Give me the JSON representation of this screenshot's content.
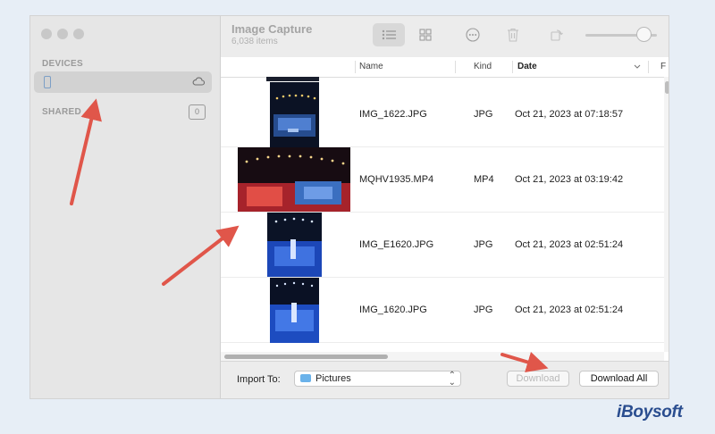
{
  "app": {
    "title": "Image Capture",
    "item_count": "6,038 items"
  },
  "sidebar": {
    "devices_heading": "DEVICES",
    "shared_heading": "SHARED",
    "shared_count": "0",
    "device": {
      "name": "",
      "icon": "iphone-icon",
      "status_icon": "cloud-icon"
    }
  },
  "toolbar": {
    "view_buttons": [
      "list-view-icon",
      "grid-view-icon"
    ],
    "actions": [
      "more-icon",
      "trash-icon",
      "rotate-icon"
    ],
    "thumbnail_size_slider": 0.85
  },
  "columns": {
    "name": "Name",
    "kind": "Kind",
    "date": "Date",
    "extra": "F"
  },
  "rows": [
    {
      "name": "IMG_1622.JPG",
      "kind": "JPG",
      "date": "Oct 21, 2023 at 07:18:57",
      "thumb": "portrait"
    },
    {
      "name": "MQHV1935.MP4",
      "kind": "MP4",
      "date": "Oct 21, 2023 at 03:19:42",
      "thumb": "landscape"
    },
    {
      "name": "IMG_E1620.JPG",
      "kind": "JPG",
      "date": "Oct 21, 2023 at 02:51:24",
      "thumb": "portrait"
    },
    {
      "name": "IMG_1620.JPG",
      "kind": "JPG",
      "date": "Oct 21, 2023 at 02:51:24",
      "thumb": "portrait"
    }
  ],
  "bottom": {
    "import_label": "Import To:",
    "import_destination": "Pictures",
    "download_label": "Download",
    "download_all_label": "Download All"
  },
  "watermark": "iBoysoft",
  "colors": {
    "arrow": "#e0564a",
    "brand": "#2a4d8f",
    "folder": "#6ab2ea"
  }
}
